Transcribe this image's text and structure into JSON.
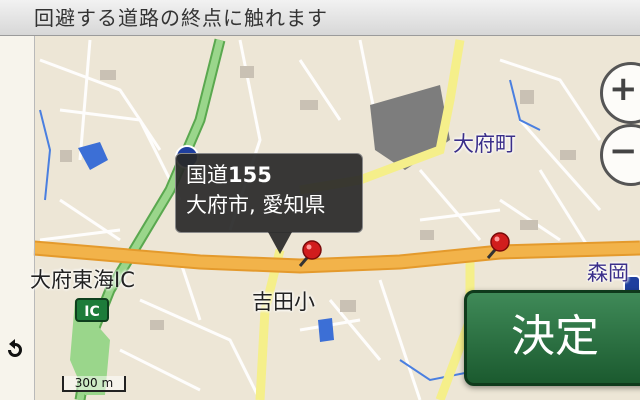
{
  "instruction": "回避する道路の終点に触れます",
  "callout": {
    "road_name": "国道",
    "road_number": "155",
    "location": "大府市, 愛知県"
  },
  "labels": {
    "town": "大府町",
    "interchange": "大府東海IC",
    "school": "吉田小",
    "district": "森岡"
  },
  "ic_badge": "IC",
  "scale": "300 m",
  "confirm_label": "決定",
  "icons": [
    "back-arrow-icon",
    "zoom-in-icon",
    "zoom-out-icon",
    "map-pin-icon",
    "route-shield-icon"
  ],
  "colors": {
    "major_road": "#f2b34a",
    "expressway": "#7fc97c",
    "secondary_road": "#f5ef8a",
    "water": "#3c6fd6",
    "confirm": "#2a7040"
  }
}
